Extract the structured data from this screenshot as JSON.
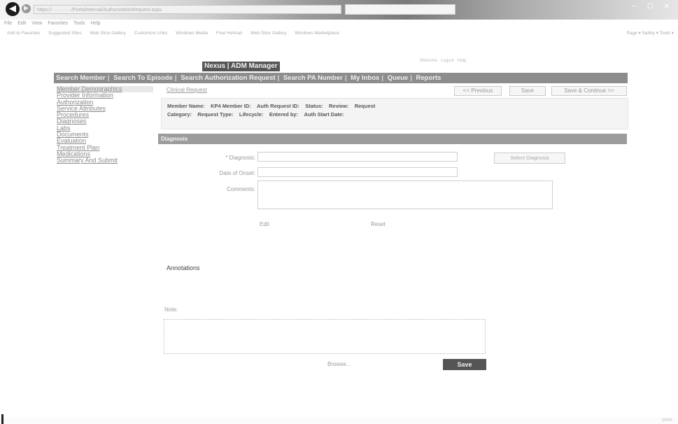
{
  "browser": {
    "address": "https://············/PortalInternal/AuthorizationRequest.aspx",
    "tab_text": "",
    "window_controls": "─ ☐ ✕",
    "menu": [
      "File",
      "Edit",
      "View",
      "Favorites",
      "Tools",
      "Help"
    ],
    "favorites": [
      "Add to Favorites",
      "Suggested Sites",
      "Web Slice Gallery",
      "Customize Links",
      "Windows Media",
      "Free Hotmail",
      "Web Slice Gallery",
      "Windows Marketplace"
    ],
    "fav_right": "Page ▾  Safety ▾  Tools ▾",
    "status_text": "",
    "zoom": "100%"
  },
  "app": {
    "title": "Nexus | ADM Manager",
    "user_info": "Welcome · Logout · Help"
  },
  "nav": [
    "Search Member",
    "Search To Episode",
    "Search Authorization Request",
    "Search PA Number",
    "My Inbox",
    "Queue",
    "Reports"
  ],
  "sidebar": [
    "Member Demographics",
    "Provider Information",
    "Authorization",
    "Service Attributes",
    "Procedures",
    "Diagnoses",
    "Labs",
    "Documents",
    "Evaluation",
    "Treatment Plan",
    "Medications",
    "Summary And Submit"
  ],
  "crumb": "Clinical Request",
  "toolbar": {
    "previous": "<< Previous",
    "save": "Save",
    "save_continue": "Save & Continue >>"
  },
  "summary": {
    "line1": [
      {
        "label": "Member Name:",
        "value": ""
      },
      {
        "label": "KP4 Member ID:",
        "value": ""
      },
      {
        "label": "Auth Request ID:",
        "value": ""
      },
      {
        "label": "Status:",
        "value": ""
      },
      {
        "label": "Review:",
        "value": ""
      },
      {
        "label": "Request",
        "value": ""
      }
    ],
    "line2": [
      {
        "label": "Category:",
        "value": ""
      },
      {
        "label": "Request Type:",
        "value": ""
      },
      {
        "label": "Lifecycle:",
        "value": ""
      },
      {
        "label": "Entered by:",
        "value": ""
      },
      {
        "label": "Auth Start Date:",
        "value": ""
      }
    ]
  },
  "section": {
    "title": "Diagnosis"
  },
  "form": {
    "diagnosis_label": "* Diagnosis:",
    "diagnosis_value": "",
    "select_button": "Select Diagnosis",
    "date_label": "Date of Onset:",
    "date_value": "",
    "comments_label": "Comments:",
    "comments_value": "",
    "ok": "Edit",
    "cancel": "Reset"
  },
  "annotations": {
    "heading": "Annotations",
    "line1": "",
    "notes_label": "Note:",
    "notes_value": "",
    "attach_label": "",
    "browse": "Browse...",
    "save": "Save",
    "footer1": "",
    "footer2": ""
  }
}
